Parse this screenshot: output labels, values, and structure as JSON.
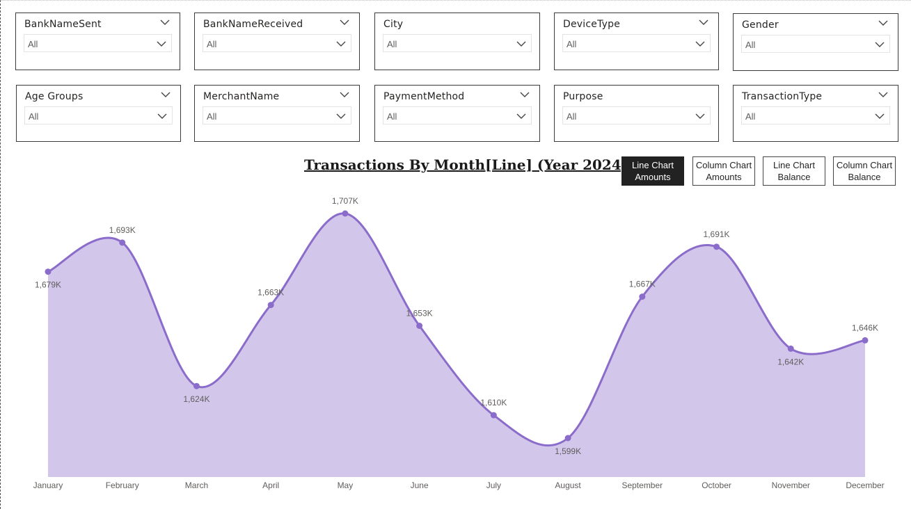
{
  "slicers": [
    {
      "title": "BankNameSent",
      "value": "All"
    },
    {
      "title": "BankNameReceived",
      "value": "All"
    },
    {
      "title": "City",
      "value": "All"
    },
    {
      "title": "DeviceType",
      "value": "All"
    },
    {
      "title": "Gender",
      "value": "All"
    },
    {
      "title": "Age Groups",
      "value": "All"
    },
    {
      "title": "MerchantName",
      "value": "All"
    },
    {
      "title": "PaymentMethod",
      "value": "All"
    },
    {
      "title": "Purpose",
      "value": "All"
    },
    {
      "title": "TransactionType",
      "value": "All"
    }
  ],
  "buttons": [
    {
      "label": "Line Chart\nAmounts",
      "active": true
    },
    {
      "label": "Column Chart\nAmounts",
      "active": false
    },
    {
      "label": "Line Chart\nBalance",
      "active": false
    },
    {
      "label": "Column Chart\nBalance",
      "active": false
    }
  ],
  "chart_data": {
    "type": "area",
    "title": "Transactions By Month[Line] (Year 2024)",
    "categories": [
      "January",
      "February",
      "March",
      "April",
      "May",
      "June",
      "July",
      "August",
      "September",
      "October",
      "November",
      "December"
    ],
    "values": [
      1679,
      1693,
      1624,
      1663,
      1707,
      1653,
      1610,
      1599,
      1667,
      1691,
      1642,
      1646
    ],
    "data_labels": [
      "1,679K",
      "1,693K",
      "1,624K",
      "1,663K",
      "1,707K",
      "1,653K",
      "1,610K",
      "1,599K",
      "1,667K",
      "1,691K",
      "1,642K",
      "1,646K"
    ],
    "unit": "K",
    "ylim": [
      1580,
      1712
    ],
    "grid": false,
    "legend": "none",
    "line_color": "#8b6ccb",
    "fill_color": "#d2c6ea"
  }
}
